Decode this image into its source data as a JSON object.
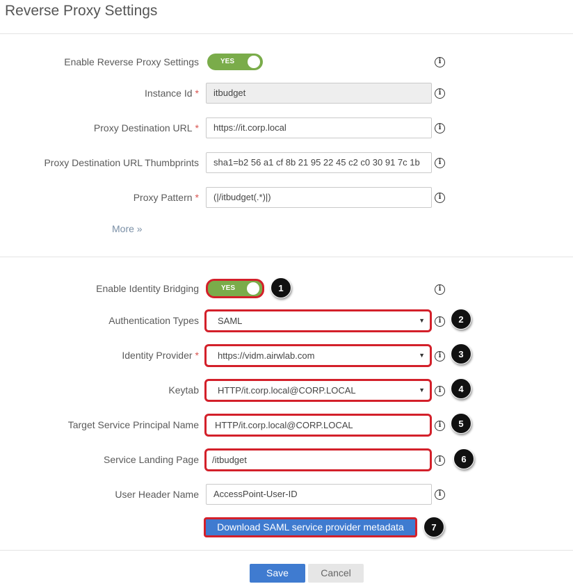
{
  "page": {
    "title": "Reverse Proxy Settings"
  },
  "reverse_proxy": {
    "enable": {
      "label": "Enable Reverse Proxy Settings",
      "toggle": "YES"
    },
    "instance_id": {
      "label": "Instance Id",
      "value": "itbudget"
    },
    "destination_url": {
      "label": "Proxy Destination URL",
      "value": "https://it.corp.local"
    },
    "thumbprints": {
      "label": "Proxy Destination URL Thumbprints",
      "value": "sha1=b2 56 a1 cf 8b 21 95 22 45 c2 c0 30 91 7c 1b"
    },
    "pattern": {
      "label": "Proxy Pattern",
      "value": "(|/itbudget(.*)|)"
    },
    "more": "More »"
  },
  "identity_bridging": {
    "enable": {
      "label": "Enable Identity Bridging",
      "toggle": "YES"
    },
    "auth_types": {
      "label": "Authentication Types",
      "value": "SAML"
    },
    "identity_provider": {
      "label": "Identity Provider",
      "value": "https://vidm.airwlab.com"
    },
    "keytab": {
      "label": "Keytab",
      "value": "HTTP/it.corp.local@CORP.LOCAL"
    },
    "target_spn": {
      "label": "Target Service Principal Name",
      "value": "HTTP/it.corp.local@CORP.LOCAL"
    },
    "landing_page": {
      "label": "Service Landing Page",
      "value": "/itbudget"
    },
    "user_header": {
      "label": "User Header Name",
      "value": "AccessPoint-User-ID"
    },
    "download_button": "Download SAML service provider metadata"
  },
  "markers": [
    "1",
    "2",
    "3",
    "4",
    "5",
    "6",
    "7"
  ],
  "common": {
    "required": "*",
    "info": "i",
    "caret": "▼"
  },
  "footer": {
    "save": "Save",
    "cancel": "Cancel"
  },
  "colors": {
    "accent": "#3f7bd0",
    "toggle": "#7aac4a",
    "highlight": "#d3202a",
    "required": "#d9534f"
  },
  "icons": {
    "info": "info-icon",
    "dropdown": "chevron-down-icon",
    "more": "double-chevron-down-icon"
  }
}
